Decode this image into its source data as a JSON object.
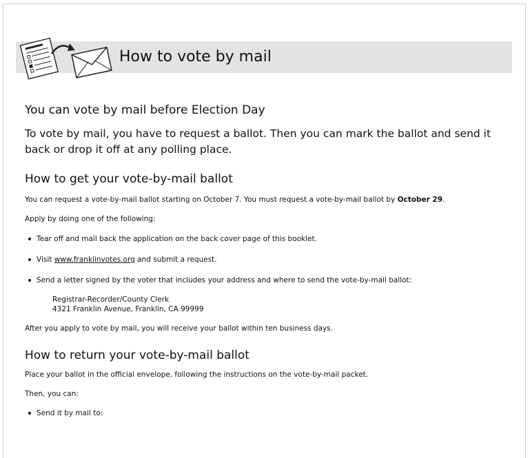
{
  "banner": {
    "title": "How to vote by mail",
    "icon": "ballot-envelope-icon"
  },
  "intro": {
    "heading": "You can vote by mail before Election Day",
    "text": "To vote by mail, you have to request a ballot. Then you can mark the ballot and send it back or drop it off at any polling place."
  },
  "get_ballot": {
    "heading": "How to get your vote-by-mail ballot",
    "p1_text": "You can request a vote-by-mail ballot starting on October 7. You must request a vote-by-mail ballot by ",
    "p1_bold": "October 29",
    "p1_end": ".",
    "apply": "Apply by doing one of the following:",
    "bullet1": "Tear off and mail back the application on the back cover page of this booklet.",
    "bullet2_pre": "Visit ",
    "bullet2_link": "www.franklinvotes.org",
    "bullet2_post": " and submit a request.",
    "bullet3": "Send a letter signed by the voter that includes your address and where to send the vote-by-mail ballot:",
    "address_line1": "Registrar-Recorder/County Clerk",
    "address_line2": "4321 Franklin Avenue, Franklin, CA 99999",
    "after": "After you apply to vote by mail, you will receive your ballot within ten business days."
  },
  "return_ballot": {
    "heading": "How to return your vote-by-mail ballot",
    "p1": "Place your ballot in the official envelope, following the instructions on the vote-by-mail packet.",
    "then": "Then, you can:",
    "bullet1": "Send it by mail to:"
  }
}
